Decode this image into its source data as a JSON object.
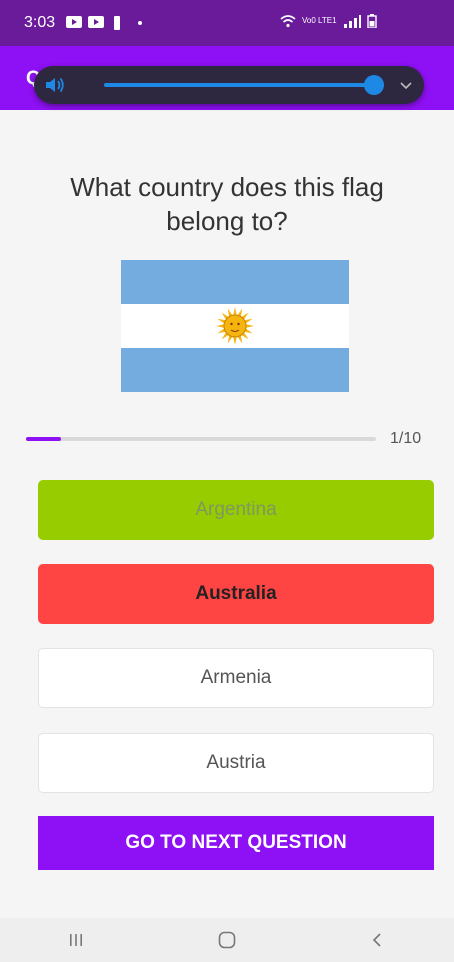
{
  "status_bar": {
    "time": "3:03",
    "network": "Vo0 LTE1"
  },
  "app_bar": {
    "title": "QuizApp"
  },
  "volume": {
    "level": 0.9
  },
  "quiz": {
    "question": "What country does this flag belong to?",
    "flag_country": "Argentina",
    "progress": {
      "current": 1,
      "total": 10,
      "label": "1/10"
    },
    "options": [
      {
        "label": "Argentina",
        "state": "correct"
      },
      {
        "label": "Australia",
        "state": "wrong"
      },
      {
        "label": "Armenia",
        "state": "default"
      },
      {
        "label": "Austria",
        "state": "default"
      }
    ],
    "next_button": "GO TO NEXT QUESTION"
  },
  "colors": {
    "primary": "#8e10f4",
    "status_bar": "#6a1b9a",
    "correct": "#96cc00",
    "wrong": "#ff4444",
    "flag_blue": "#74acdf",
    "flag_sun": "#f6b40e"
  },
  "icons": [
    "youtube-icon",
    "flashlight-icon",
    "wifi-icon",
    "signal-icon",
    "battery-icon",
    "speaker-icon",
    "chevron-down-icon",
    "recents-icon",
    "home-icon",
    "back-icon"
  ]
}
